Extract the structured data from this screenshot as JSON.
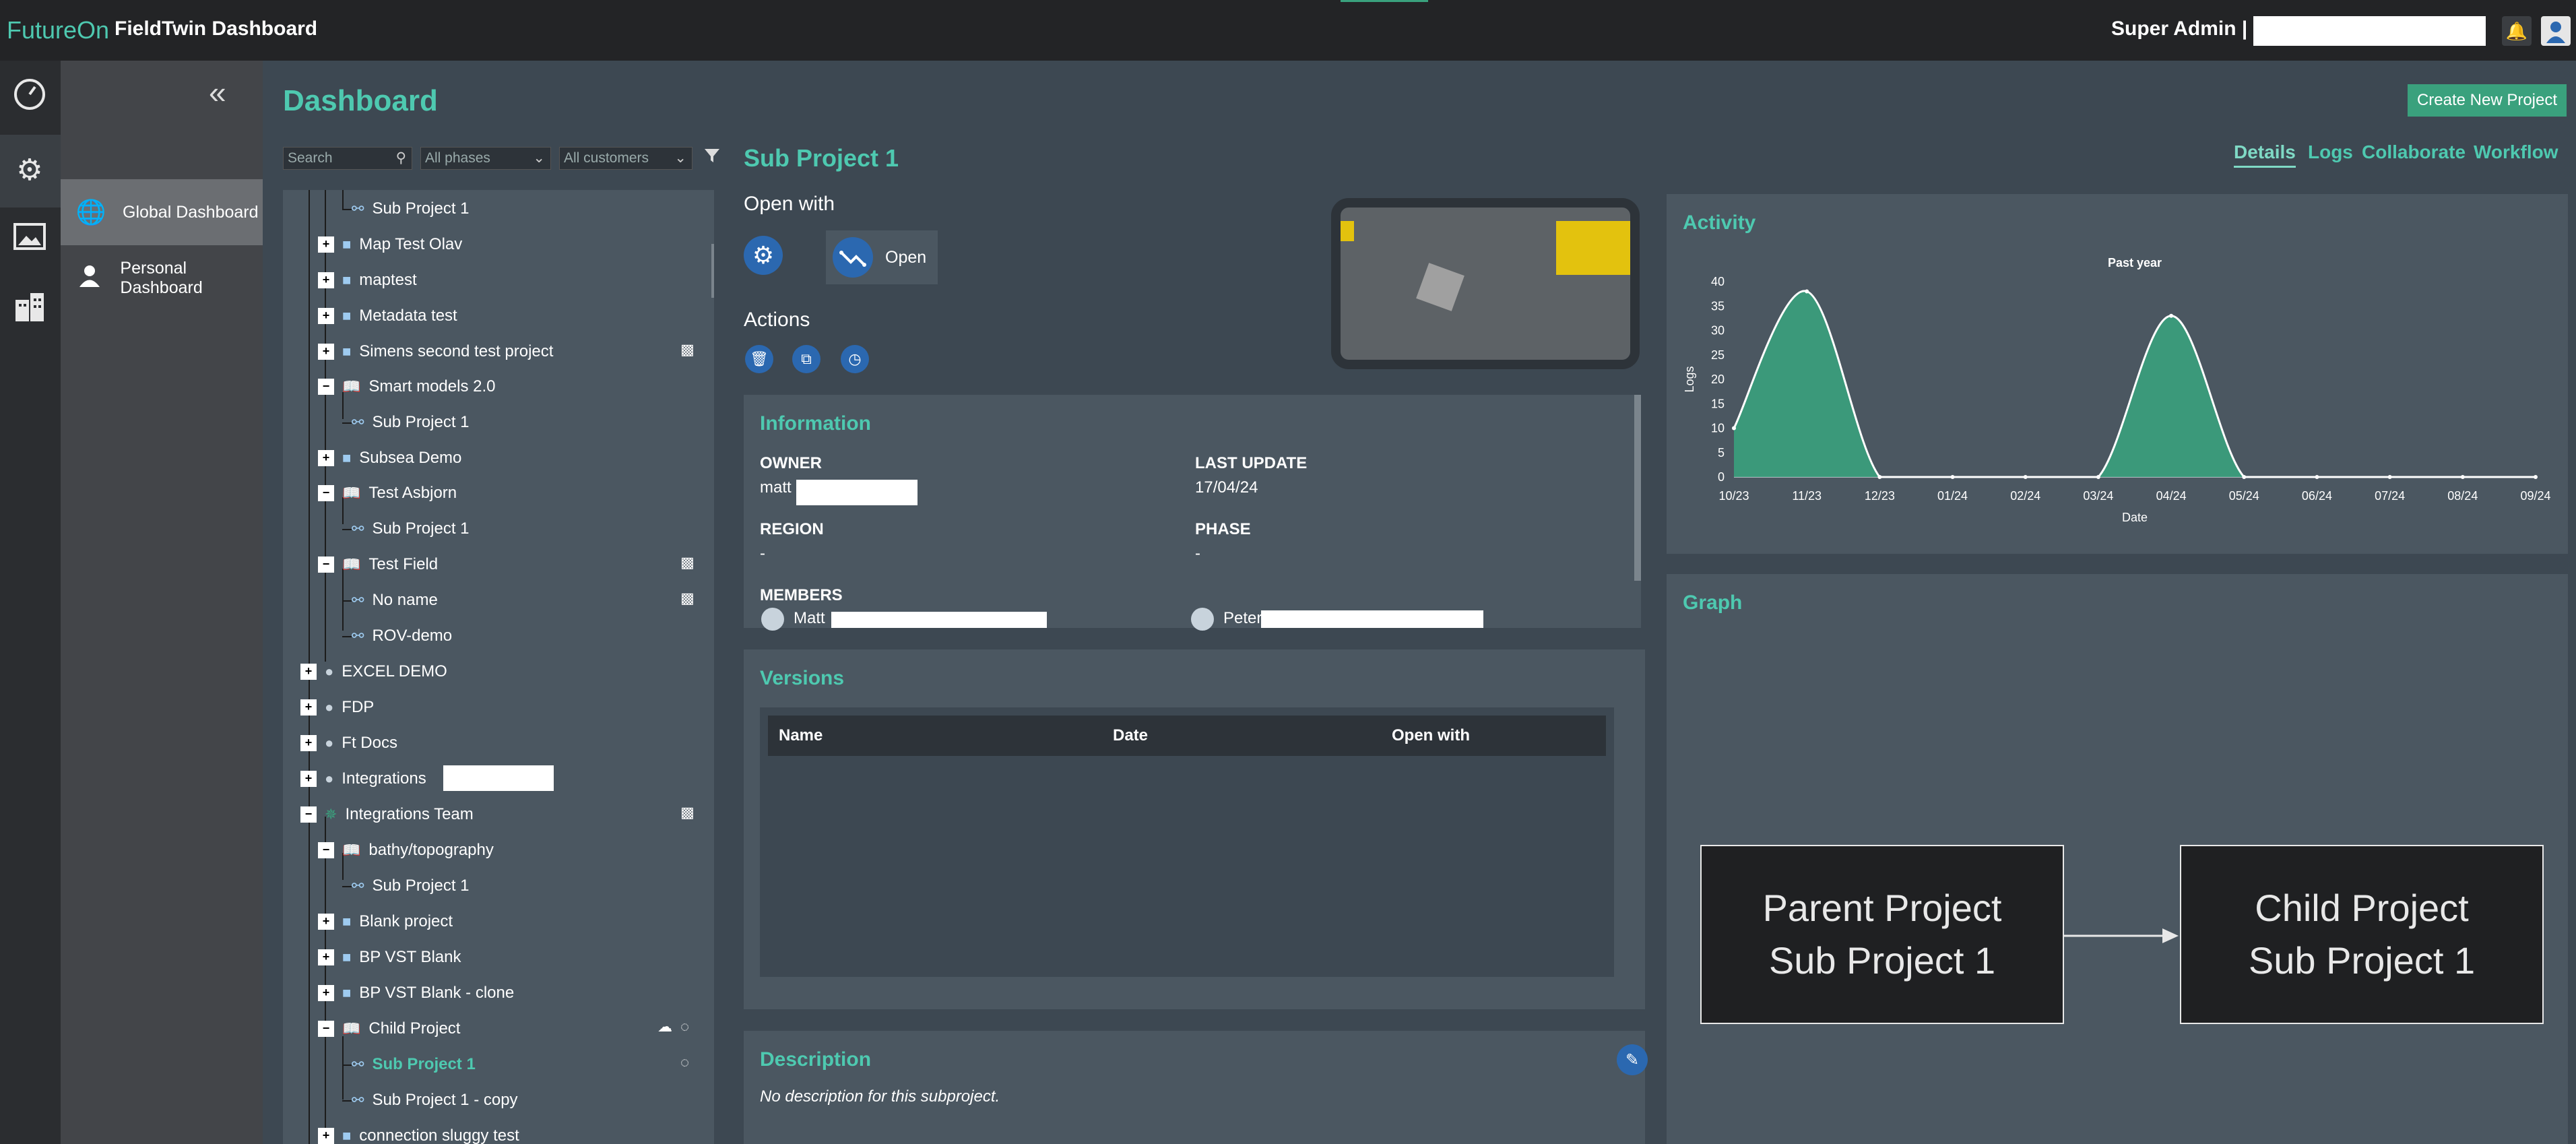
{
  "topbar": {
    "brand": "FutureOn",
    "app_title": "FieldTwin Dashboard",
    "user_label": "Super Admin |",
    "notification_icon": "bell-icon",
    "avatar_icon": "user-icon"
  },
  "rail": {
    "items": [
      "dashboard-gauge-icon",
      "settings-gear-icon",
      "gallery-icon",
      "buildings-icon"
    ]
  },
  "sidebar": {
    "items": [
      {
        "label": "Global Dashboard",
        "icon": "globe-icon",
        "active": true
      },
      {
        "label": "Personal Dashboard",
        "icon": "person-icon",
        "active": false
      }
    ]
  },
  "page": {
    "title": "Dashboard",
    "create_button": "Create New Project"
  },
  "filters": {
    "search_placeholder": "Search",
    "phases": "All phases",
    "customers": "All customers"
  },
  "tree": [
    {
      "label": "Sub Project 1",
      "type": "sub",
      "level": 2
    },
    {
      "label": "Map Test Olav",
      "type": "project",
      "level": 1
    },
    {
      "label": "maptest",
      "type": "project",
      "level": 1
    },
    {
      "label": "Metadata test",
      "type": "project",
      "level": 1
    },
    {
      "label": "Simens second test project",
      "type": "project",
      "level": 1
    },
    {
      "label": "Smart models 2.0",
      "type": "field",
      "level": 1
    },
    {
      "label": "Sub Project 1",
      "type": "sub",
      "level": 2
    },
    {
      "label": "Subsea Demo",
      "type": "project",
      "level": 1
    },
    {
      "label": "Test Asbjorn",
      "type": "field",
      "level": 1
    },
    {
      "label": "Sub Project 1",
      "type": "sub",
      "level": 2
    },
    {
      "label": "Test Field",
      "type": "field",
      "level": 1
    },
    {
      "label": "No name",
      "type": "sub",
      "level": 2
    },
    {
      "label": "ROV-demo",
      "type": "sub",
      "level": 2
    },
    {
      "label": "EXCEL DEMO",
      "type": "account",
      "level": 0
    },
    {
      "label": "FDP",
      "type": "account",
      "level": 0
    },
    {
      "label": "Ft Docs",
      "type": "account",
      "level": 0
    },
    {
      "label": "Integrations",
      "type": "account",
      "level": 0
    },
    {
      "label": "Integrations Team",
      "type": "team",
      "level": 0
    },
    {
      "label": "bathy/topography",
      "type": "field",
      "level": 1
    },
    {
      "label": "Sub Project 1",
      "type": "sub",
      "level": 2
    },
    {
      "label": "Blank project",
      "type": "project",
      "level": 1
    },
    {
      "label": "BP VST Blank",
      "type": "project",
      "level": 1
    },
    {
      "label": "BP VST Blank - clone",
      "type": "project",
      "level": 1
    },
    {
      "label": "Child Project",
      "type": "field",
      "level": 1
    },
    {
      "label": "Sub Project 1",
      "type": "sub",
      "level": 2,
      "selected": true
    },
    {
      "label": "Sub Project 1 - copy",
      "type": "sub",
      "level": 2
    },
    {
      "label": "connection sluggy test",
      "type": "project",
      "level": 1
    }
  ],
  "detail": {
    "title": "Sub Project 1",
    "open_with_label": "Open with",
    "open_button": "Open",
    "actions_label": "Actions",
    "action_icons": [
      "trash-icon",
      "copy-icon",
      "clock-icon"
    ],
    "information": {
      "title": "Information",
      "owner_label": "OWNER",
      "owner_value": "matt",
      "last_update_label": "LAST UPDATE",
      "last_update_value": "17/04/24",
      "region_label": "REGION",
      "region_value": "-",
      "phase_label": "PHASE",
      "phase_value": "-",
      "members_label": "MEMBERS",
      "members": [
        "Matt",
        "Peter"
      ]
    },
    "versions": {
      "title": "Versions",
      "columns": [
        "Name",
        "Date",
        "Open with"
      ]
    },
    "description": {
      "title": "Description",
      "text": "No description for this subproject."
    }
  },
  "right_tabs": [
    {
      "label": "Details",
      "active": true
    },
    {
      "label": "Logs",
      "active": false
    },
    {
      "label": "Collaborate",
      "active": false
    },
    {
      "label": "Workflow",
      "active": false
    }
  ],
  "activity": {
    "title": "Activity"
  },
  "chart_data": {
    "type": "area",
    "title": "Past year",
    "xlabel": "Date",
    "ylabel": "Logs",
    "x": [
      "10/23",
      "11/23",
      "12/23",
      "01/24",
      "02/24",
      "03/24",
      "04/24",
      "05/24",
      "06/24",
      "07/24",
      "08/24",
      "09/24"
    ],
    "values": [
      10,
      38,
      0,
      0,
      0,
      0,
      33,
      0,
      0,
      0,
      0,
      0
    ],
    "ylim": [
      0,
      40
    ],
    "yticks": [
      0,
      5,
      10,
      15,
      20,
      25,
      30,
      35,
      40
    ],
    "color": "#3aa17d"
  },
  "graph": {
    "title": "Graph",
    "parent": [
      "Parent Project",
      "Sub Project 1"
    ],
    "child": [
      "Child Project",
      "Sub Project 1"
    ]
  }
}
